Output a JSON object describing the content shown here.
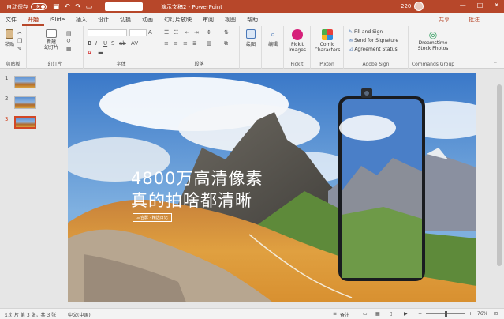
{
  "titlebar": {
    "autosave_label": "自动保存",
    "autosave_state": "关",
    "document_title": "演示文稿2 - PowerPoint",
    "user_name": "220",
    "window_controls": [
      "—",
      "□",
      "✕"
    ]
  },
  "tabs": [
    "文件",
    "开始",
    "iSlide",
    "插入",
    "设计",
    "切换",
    "动画",
    "幻灯片放映",
    "审阅",
    "视图",
    "帮助"
  ],
  "active_tab": "开始",
  "share_label": "共享",
  "comments_label": "批注",
  "ribbon": {
    "clipboard": {
      "paste": "粘贴",
      "label": "剪贴板"
    },
    "slides": {
      "new_slide": "新建\n幻灯片",
      "label": "幻灯片"
    },
    "font": {
      "label": "字体",
      "size_placeholder": ""
    },
    "paragraph": {
      "label": "段落"
    },
    "drawing": {
      "button": "绘图"
    },
    "editing": {
      "button": "编辑"
    },
    "pickit": {
      "button_line1": "Pickit",
      "button_line2": "Images",
      "label": "Pickit"
    },
    "pixton": {
      "button_line1": "Comic",
      "button_line2": "Characters",
      "label": "Pixton"
    },
    "adobe_sign": {
      "items": [
        "Fill and Sign",
        "Send for Signature",
        "Agreement Status"
      ],
      "label": "Adobe Sign"
    },
    "commands": {
      "button_line1": "Dreamstime",
      "button_line2": "Stock Photos",
      "label": "Commands Group"
    }
  },
  "thumbnails": [
    "1",
    "2",
    "3"
  ],
  "active_thumbnail": 3,
  "slide": {
    "headline_line1": "4800万高清像素",
    "headline_line2": "真的拍啥都清晰",
    "tagline": "三合影 · 精选日记"
  },
  "statusbar": {
    "slide_info": "幻灯片 第 3 张，共 3 张",
    "language": "中文(中国)",
    "notes": "备注",
    "zoom": "76%"
  },
  "colors": {
    "accent": "#b7472a",
    "ribbon_bg": "#f3f3f3",
    "canvas_bg": "#e6e6e6"
  }
}
